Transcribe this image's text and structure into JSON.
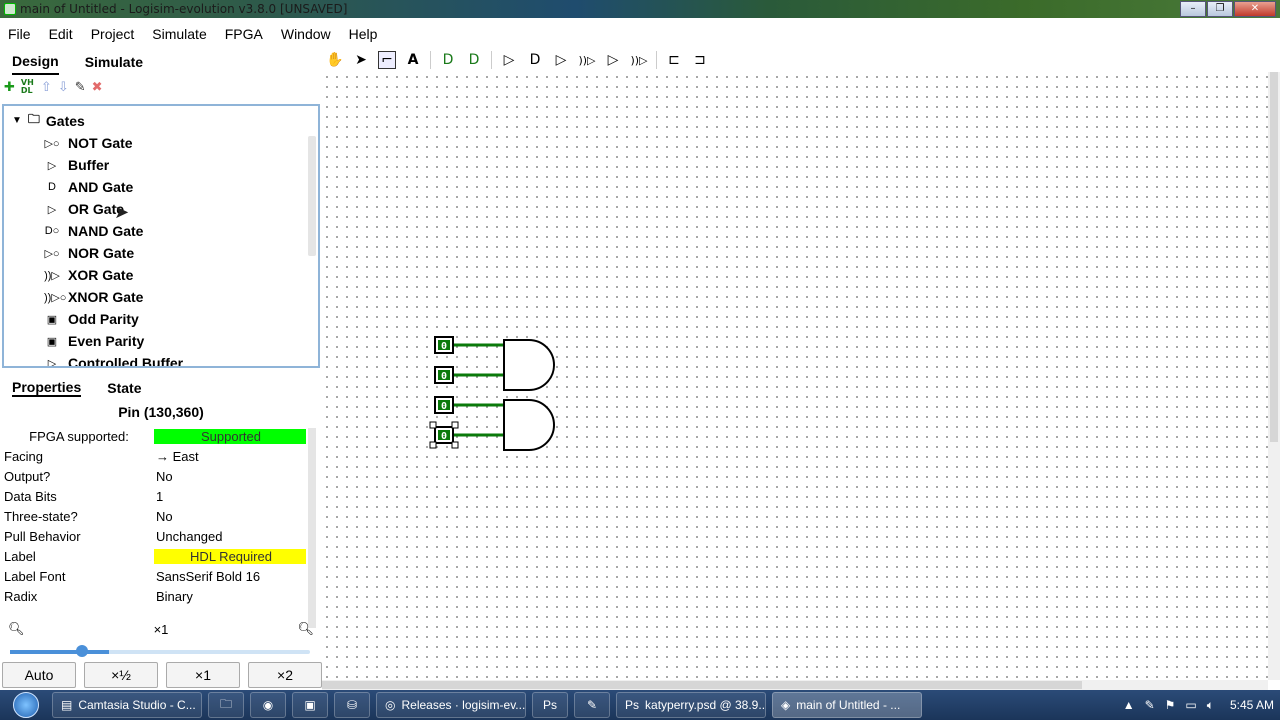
{
  "window": {
    "title": "main of Untitled - Logisim-evolution v3.8.0 [UNSAVED]",
    "min": "–",
    "max": "❐",
    "close": "✕"
  },
  "menu": [
    "File",
    "Edit",
    "Project",
    "Simulate",
    "FPGA",
    "Window",
    "Help"
  ],
  "left_tabs": {
    "design": "Design",
    "simulate": "Simulate"
  },
  "tree_toolbar": {
    "add": "✚",
    "vhdl": "VH DL",
    "up": "⇧",
    "down": "⇩",
    "edit": "✎",
    "delete": "✖"
  },
  "tree": {
    "root": "Gates",
    "items": [
      {
        "label": "NOT Gate",
        "icon": "▷○"
      },
      {
        "label": "Buffer",
        "icon": "▷"
      },
      {
        "label": "AND Gate",
        "icon": "D"
      },
      {
        "label": "OR Gate",
        "icon": "▷"
      },
      {
        "label": "NAND Gate",
        "icon": "D○"
      },
      {
        "label": "NOR Gate",
        "icon": "▷○"
      },
      {
        "label": "XOR Gate",
        "icon": "))▷"
      },
      {
        "label": "XNOR Gate",
        "icon": "))▷○"
      },
      {
        "label": "Odd Parity",
        "icon": "▣"
      },
      {
        "label": "Even Parity",
        "icon": "▣"
      },
      {
        "label": "Controlled Buffer",
        "icon": "▷"
      }
    ]
  },
  "prop_tabs": {
    "properties": "Properties",
    "state": "State"
  },
  "props_title": "Pin (130,360)",
  "properties": [
    {
      "key": "FPGA supported:",
      "value": "Supported",
      "style": "green",
      "center_key": true
    },
    {
      "key": "Facing",
      "value": "→ East",
      "style": ""
    },
    {
      "key": "Output?",
      "value": "No",
      "style": ""
    },
    {
      "key": "Data Bits",
      "value": "1",
      "style": ""
    },
    {
      "key": "Three-state?",
      "value": "No",
      "style": ""
    },
    {
      "key": "Pull Behavior",
      "value": "Unchanged",
      "style": ""
    },
    {
      "key": "Label",
      "value": "HDL Required",
      "style": "yellow"
    },
    {
      "key": "Label Font",
      "value": "SansSerif Bold 16",
      "style": ""
    },
    {
      "key": "Radix",
      "value": "Binary",
      "style": ""
    }
  ],
  "zoom": {
    "label": "×1",
    "buttons": [
      "Auto",
      "×½",
      "×1",
      "×2"
    ]
  },
  "canvas_toolbar": [
    "✋",
    "➤",
    "⌐",
    "A",
    "D",
    "D",
    "▷",
    "D",
    "▷",
    "))▷",
    "▷",
    "))▷",
    "⊏",
    "⊐"
  ],
  "circuit": {
    "pin_value": "0"
  },
  "taskbar": {
    "items": [
      {
        "label": "Camtasia Studio - C...",
        "type": "wide"
      },
      {
        "label": "",
        "type": "icon"
      },
      {
        "label": "",
        "type": "icon"
      },
      {
        "label": "",
        "type": "icon"
      },
      {
        "label": "",
        "type": "icon"
      },
      {
        "label": "Releases · logisim-ev...",
        "type": "wide"
      },
      {
        "label": "",
        "type": "icon"
      },
      {
        "label": "",
        "type": "icon"
      },
      {
        "label": "katyperry.psd @ 38.9...",
        "type": "wide"
      },
      {
        "label": "main of Untitled - ...",
        "type": "wide",
        "active": true
      }
    ],
    "clock": "5:45 AM"
  }
}
